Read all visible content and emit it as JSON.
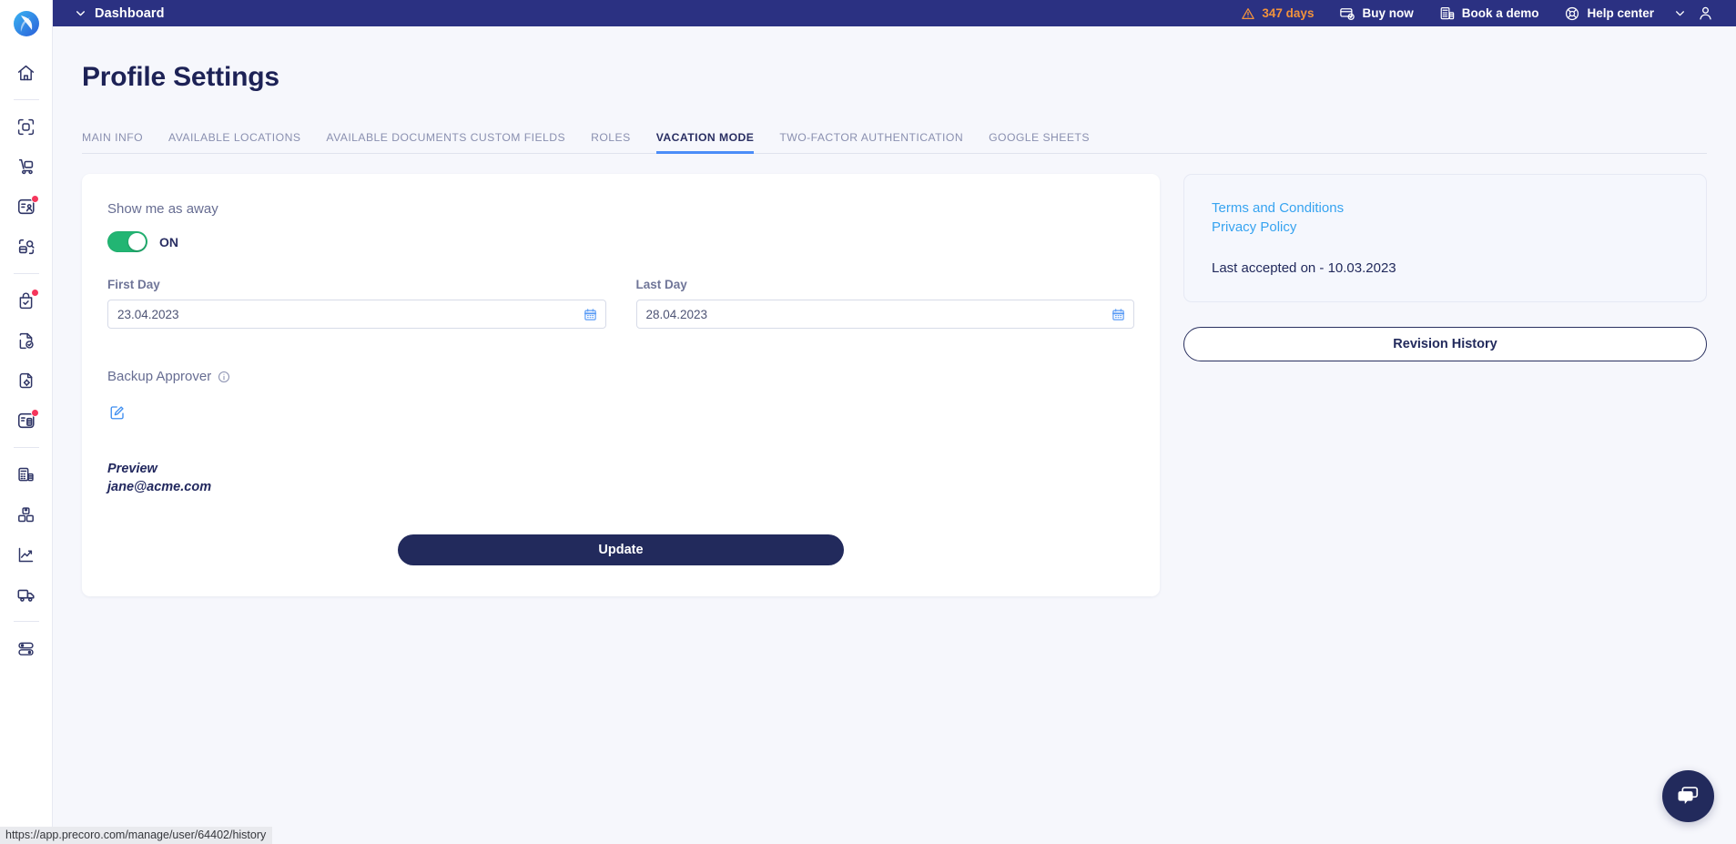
{
  "brand": {
    "accent_blue": "#4b8df8",
    "navy": "#222a5c",
    "topbar_bg": "#2b3182",
    "toggle_green": "#22b573",
    "warning_orange": "#f2933c",
    "link_blue": "#36a3f0"
  },
  "topbar": {
    "menu_title": "Dashboard",
    "trial": {
      "icon": "warning-triangle-icon",
      "label": "347 days"
    },
    "actions": [
      {
        "name": "buy-now",
        "icon": "card-check-icon",
        "label": "Buy now"
      },
      {
        "name": "book-a-demo",
        "icon": "calculator-icon",
        "label": "Book a demo"
      },
      {
        "name": "help-center",
        "icon": "lifebuoy-icon",
        "label": "Help center"
      }
    ],
    "caret_icon": "chevron-down-icon",
    "avatar_icon": "user-avatar-icon"
  },
  "sidebar": {
    "logo": "precoro-logo",
    "items": [
      {
        "name": "home",
        "icon": "home-icon",
        "badge": false
      },
      {
        "name": "scan-document",
        "icon": "scan-document-icon",
        "badge": false
      },
      {
        "name": "purchase-requisition",
        "icon": "trolley-icon",
        "badge": false
      },
      {
        "name": "requests-approvals",
        "icon": "list-person-icon",
        "badge": true
      },
      {
        "name": "supplier-search",
        "icon": "receive-search-icon",
        "badge": false
      },
      {
        "name": "approvals-check",
        "icon": "bag-check-icon",
        "badge": true
      },
      {
        "name": "invoices",
        "icon": "document-check-icon",
        "badge": false
      },
      {
        "name": "payments",
        "icon": "document-settings-icon",
        "badge": false
      },
      {
        "name": "tasks",
        "icon": "list-database-icon",
        "badge": true
      },
      {
        "name": "budgets",
        "icon": "calculator-doc-icon",
        "badge": false
      },
      {
        "name": "warehouse",
        "icon": "boxes-icon",
        "badge": false
      },
      {
        "name": "reports",
        "icon": "chart-trend-icon",
        "badge": false
      },
      {
        "name": "deliveries",
        "icon": "truck-icon",
        "badge": false
      },
      {
        "name": "configuration",
        "icon": "toggles-icon",
        "badge": false
      }
    ]
  },
  "page": {
    "title": "Profile Settings"
  },
  "tabs": [
    {
      "label": "MAIN INFO",
      "active": false
    },
    {
      "label": "AVAILABLE LOCATIONS",
      "active": false
    },
    {
      "label": "AVAILABLE DOCUMENTS CUSTOM FIELDS",
      "active": false
    },
    {
      "label": "ROLES",
      "active": false
    },
    {
      "label": "VACATION MODE",
      "active": true
    },
    {
      "label": "TWO-FACTOR AUTHENTICATION",
      "active": false
    },
    {
      "label": "GOOGLE SHEETS",
      "active": false
    }
  ],
  "vacation": {
    "show_away_label": "Show me as away",
    "toggle_state": "ON",
    "first_day": {
      "label": "First Day",
      "value": "23.04.2023",
      "placeholder": "DD.MM.YYYY",
      "icon": "calendar-icon"
    },
    "last_day": {
      "label": "Last Day",
      "value": "28.04.2023",
      "placeholder": "DD.MM.YYYY",
      "icon": "calendar-icon"
    },
    "backup_approver": {
      "label": "Backup Approver",
      "info_icon": "info-circle-icon",
      "edit_icon": "edit-square-icon"
    },
    "preview": {
      "heading": "Preview",
      "email": "jane@acme.com"
    },
    "update_label": "Update"
  },
  "terms_panel": {
    "terms_link": "Terms and Conditions",
    "privacy_link": "Privacy Policy",
    "last_accepted": "Last accepted on - 10.03.2023",
    "revision_history_label": "Revision History"
  },
  "chat": {
    "icon": "chat-bubbles-icon"
  },
  "status_bar": {
    "url": "https://app.precoro.com/manage/user/64402/history"
  }
}
